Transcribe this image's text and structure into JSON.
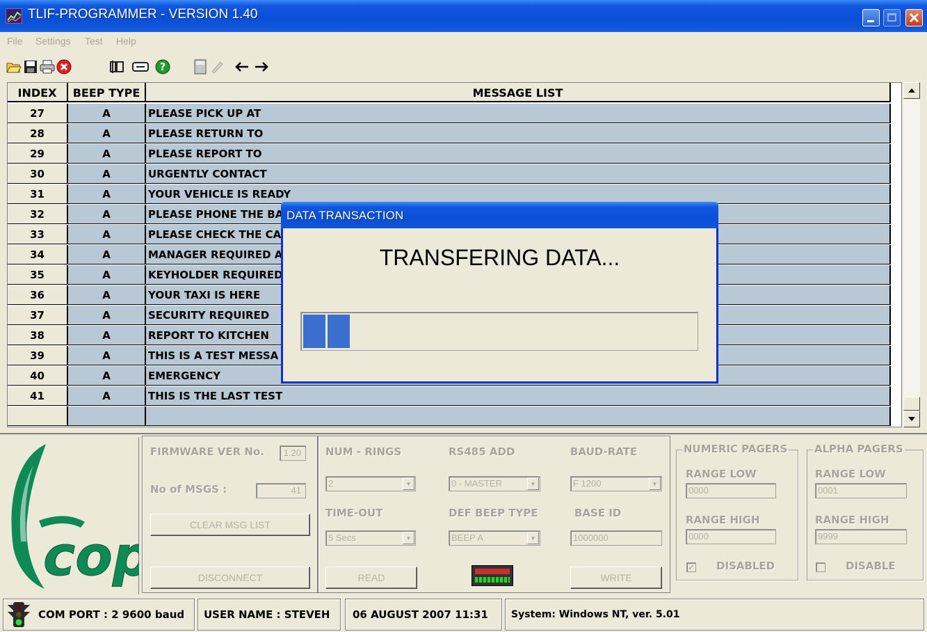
{
  "window": {
    "title": "TLIF-PROGRAMMER - VERSION 1.40"
  },
  "menu": [
    "File",
    "Settings",
    "Test",
    "Help"
  ],
  "toolbar": {
    "icons": [
      "open-icon",
      "save-icon",
      "print-icon",
      "stop-icon",
      "keyboard-icon",
      "port-icon",
      "help-icon",
      "calculator-icon",
      "pen-icon",
      "arrow-left-icon",
      "arrow-right-icon"
    ]
  },
  "table": {
    "headers": {
      "index": "INDEX",
      "beep": "BEEP TYPE",
      "message": "MESSAGE LIST"
    },
    "rows": [
      {
        "index": "27",
        "beep": "A",
        "message": "PLEASE PICK UP AT"
      },
      {
        "index": "28",
        "beep": "A",
        "message": "PLEASE RETURN TO"
      },
      {
        "index": "29",
        "beep": "A",
        "message": "PLEASE REPORT TO"
      },
      {
        "index": "30",
        "beep": "A",
        "message": "URGENTLY CONTACT"
      },
      {
        "index": "31",
        "beep": "A",
        "message": "YOUR VEHICLE IS READY"
      },
      {
        "index": "32",
        "beep": "A",
        "message": "PLEASE PHONE THE BA"
      },
      {
        "index": "33",
        "beep": "A",
        "message": "PLEASE CHECK THE CA"
      },
      {
        "index": "34",
        "beep": "A",
        "message": "MANAGER REQUIRED A"
      },
      {
        "index": "35",
        "beep": "A",
        "message": "KEYHOLDER REQUIRED"
      },
      {
        "index": "36",
        "beep": "A",
        "message": "YOUR TAXI IS HERE"
      },
      {
        "index": "37",
        "beep": "A",
        "message": "SECURITY REQUIRED"
      },
      {
        "index": "38",
        "beep": "A",
        "message": "REPORT TO KITCHEN"
      },
      {
        "index": "39",
        "beep": "A",
        "message": "THIS IS A TEST MESSA"
      },
      {
        "index": "40",
        "beep": "A",
        "message": "EMERGENCY"
      },
      {
        "index": "41",
        "beep": "A",
        "message": "THIS IS THE LAST TEST"
      },
      {
        "index": "",
        "beep": "",
        "message": ""
      }
    ]
  },
  "settings": {
    "firmware_label": "FIRMWARE VER No.",
    "firmware_value": "1.20",
    "msgs_label": "No of MSGS :",
    "msgs_value": "41",
    "clear_button": "CLEAR MSG LIST",
    "disconnect_button": "DISCONNECT",
    "read_button": "READ",
    "write_button": "WRITE",
    "num_rings_label": "NUM - RINGS",
    "num_rings_value": "2",
    "rs485_label": "RS485 ADD",
    "rs485_value": "0 - MASTER",
    "baud_label": "BAUD-RATE",
    "baud_value": "F 1200",
    "timeout_label": "TIME-OUT",
    "timeout_value": "5 Secs",
    "def_beep_label": "DEF BEEP TYPE",
    "def_beep_value": "BEEP A",
    "base_id_label": "BASE ID",
    "base_id_value": "1000000"
  },
  "numeric_pagers": {
    "title": "NUMERIC PAGERS",
    "range_low_label": "RANGE LOW",
    "range_low_value": "0000",
    "range_high_label": "RANGE HIGH",
    "range_high_value": "0000",
    "disabled_label": "DISABLED",
    "disabled_checked": true
  },
  "alpha_pagers": {
    "title": "ALPHA PAGERS",
    "range_low_label": "RANGE LOW",
    "range_low_value": "0001",
    "range_high_label": "RANGE HIGH",
    "range_high_value": "9999",
    "disabled_label": "DISABLE",
    "disabled_checked": false
  },
  "logo": {
    "text": "cope"
  },
  "status": {
    "com_port": "COM PORT : 2  9600 baud",
    "user": "USER NAME : STEVEH",
    "datetime": "06 AUGUST 2007  11:31",
    "system": "System: Windows NT, ver. 5.01"
  },
  "dialog": {
    "title": "DATA TRANSACTION",
    "message": "TRANSFERING DATA...",
    "progress_blocks": 2
  },
  "colors": {
    "titlebar": "#0a4fd6",
    "row_fill": "#b8c9d5",
    "logo_green": "#0e8a55",
    "progress_block": "#3a6fcf"
  }
}
